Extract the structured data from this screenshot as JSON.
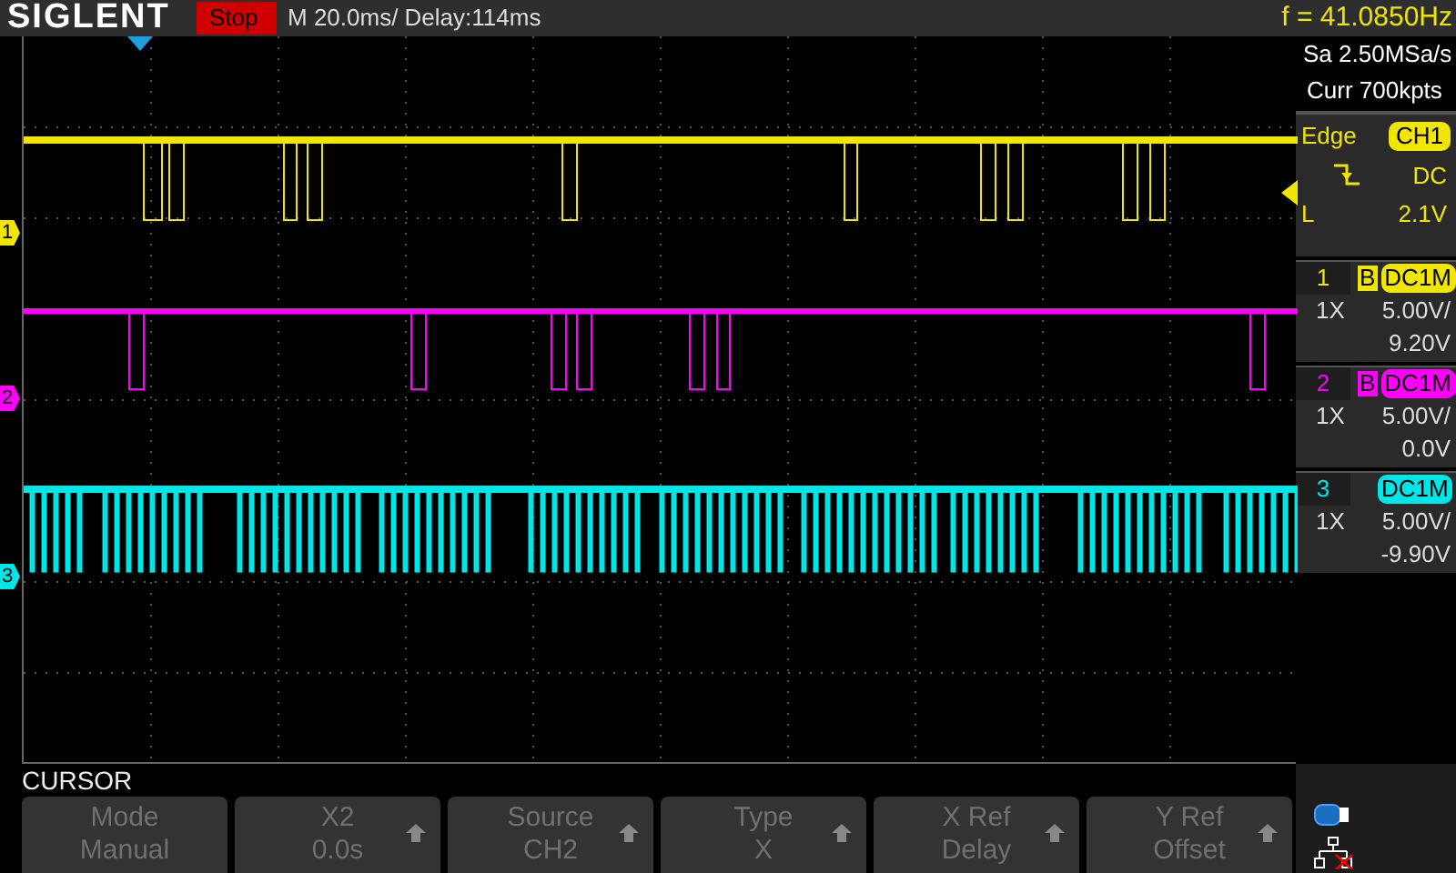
{
  "header": {
    "logo": "SIGLENT",
    "run_state": "Stop",
    "timebase": "M 20.0ms/ Delay:114ms",
    "frequency": "f = 41.0850Hz"
  },
  "acquisition": {
    "sample_rate": "Sa 2.50MSa/s",
    "memory": "Curr 700kpts"
  },
  "trigger": {
    "type": "Edge",
    "source": "CH1",
    "coupling": "DC",
    "level_label": "L",
    "level_value": "2.1V"
  },
  "channels": [
    {
      "marker": "1",
      "number": "1",
      "color": "#f0e600",
      "bandwidth_limit": "B",
      "coupling": "DC1M",
      "probe": "1X",
      "scale": "5.00V/",
      "offset": "9.20V"
    },
    {
      "marker": "2",
      "number": "2",
      "color": "#ff00ff",
      "bandwidth_limit": "B",
      "coupling": "DC1M",
      "probe": "1X",
      "scale": "5.00V/",
      "offset": "0.0V"
    },
    {
      "marker": "3",
      "number": "3",
      "color": "#00e6e6",
      "coupling": "DC1M",
      "probe": "1X",
      "scale": "5.00V/",
      "offset": "-9.90V"
    }
  ],
  "menu": {
    "title": "CURSOR",
    "buttons": [
      {
        "label": "Mode",
        "value": "Manual",
        "arrow": false
      },
      {
        "label": "X2",
        "value": "0.0s",
        "arrow": true
      },
      {
        "label": "Source",
        "value": "CH2",
        "arrow": true
      },
      {
        "label": "Type",
        "value": "X",
        "arrow": true
      },
      {
        "label": "X Ref",
        "value": "Delay",
        "arrow": true
      },
      {
        "label": "Y Ref",
        "value": "Offset",
        "arrow": true
      }
    ]
  }
}
